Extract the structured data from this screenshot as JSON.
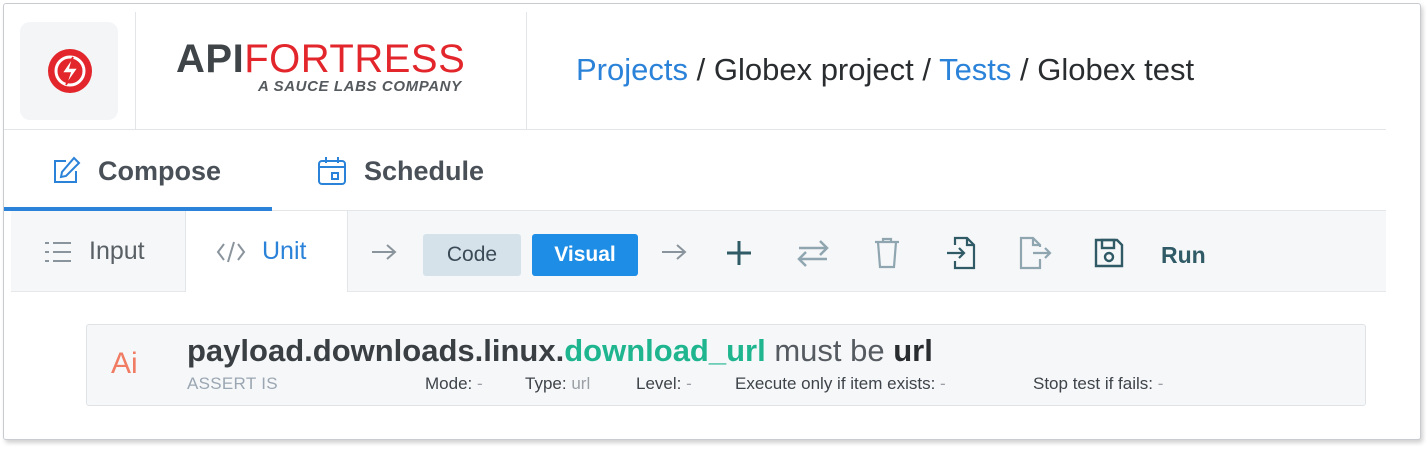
{
  "header": {
    "brand": {
      "title_bold": "API",
      "title_light": "FORTRESS",
      "subtitle": "A SAUCE LABS COMPANY"
    },
    "breadcrumb": [
      {
        "label": "Projects",
        "link": true
      },
      {
        "label": "Globex project",
        "link": false
      },
      {
        "label": "Tests",
        "link": true
      },
      {
        "label": "Globex test",
        "link": false
      }
    ],
    "separator": "/"
  },
  "tabs": [
    {
      "label": "Compose",
      "icon": "edit-icon",
      "active": true
    },
    {
      "label": "Schedule",
      "icon": "calendar-icon",
      "active": false
    }
  ],
  "toolbar": {
    "input_label": "Input",
    "unit_label": "Unit",
    "code_label": "Code",
    "visual_label": "Visual",
    "run_label": "Run",
    "icons": [
      "add-icon",
      "swap-icon",
      "trash-icon",
      "import-icon",
      "export-icon",
      "save-icon"
    ]
  },
  "assertion": {
    "icon_text": "Ai",
    "path": "payload.downloads.linux.",
    "key": "download_url",
    "verb": "must be",
    "type": "url",
    "kind": "ASSERT IS",
    "mode_label": "Mode:",
    "mode_value": "-",
    "type_label": "Type:",
    "type_value": "url",
    "level_label": "Level:",
    "level_value": "-",
    "exists_label": "Execute only if item exists:",
    "exists_value": "-",
    "stop_label": "Stop test if fails:",
    "stop_value": "-"
  },
  "colors": {
    "link": "#2b82d9",
    "brand_red": "#e2262b",
    "accent_green": "#1fb58f",
    "visual_button": "#1e8de6",
    "code_button": "#d6e2ea"
  }
}
